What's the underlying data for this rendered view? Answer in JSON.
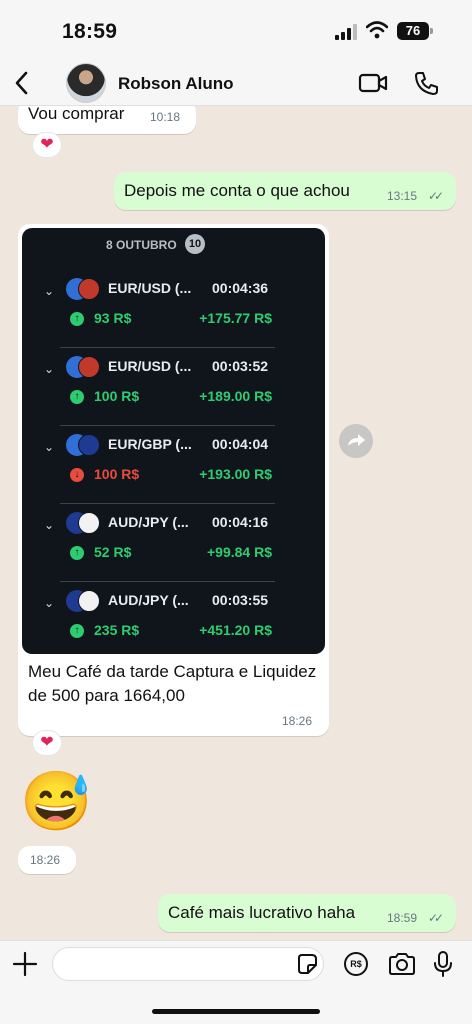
{
  "status": {
    "time": "18:59",
    "battery": "76"
  },
  "header": {
    "contact_name": "Robson Aluno"
  },
  "messages": {
    "m1": {
      "text": "Vou comprar",
      "time": "10:18",
      "reaction": "❤"
    },
    "m2": {
      "text": "Depois me conta o que achou",
      "time": "13:15",
      "ticks": "✓✓"
    },
    "m3": {
      "caption": "Meu Café da tarde Captura e Liquidez de 500 para 1664,00",
      "time": "18:26",
      "reaction": "❤",
      "image": {
        "date": "8 OUTUBRO",
        "count": "10",
        "trades": [
          {
            "pair": "EUR/USD (...",
            "duration": "00:04:36",
            "stake": "93 R$",
            "profit": "+175.77 R$",
            "direction": "up",
            "flags": [
              "#2f6fd6",
              "#c0392b"
            ]
          },
          {
            "pair": "EUR/USD (...",
            "duration": "00:03:52",
            "stake": "100 R$",
            "profit": "+189.00 R$",
            "direction": "up",
            "flags": [
              "#2f6fd6",
              "#c0392b"
            ]
          },
          {
            "pair": "EUR/GBP (...",
            "duration": "00:04:04",
            "stake": "100 R$",
            "profit": "+193.00 R$",
            "direction": "down",
            "flags": [
              "#2f6fd6",
              "#1f3a93"
            ]
          },
          {
            "pair": "AUD/JPY (...",
            "duration": "00:04:16",
            "stake": "52 R$",
            "profit": "+99.84 R$",
            "direction": "up",
            "flags": [
              "#1f3a93",
              "#f2f2f2"
            ]
          },
          {
            "pair": "AUD/JPY (...",
            "duration": "00:03:55",
            "stake": "235 R$",
            "profit": "+451.20 R$",
            "direction": "up",
            "flags": [
              "#1f3a93",
              "#f2f2f2"
            ]
          }
        ]
      }
    },
    "m4": {
      "emoji": "😅",
      "time": "18:26"
    },
    "m5": {
      "text": "Café mais lucrativo haha",
      "time": "18:59",
      "ticks": "✓✓"
    }
  },
  "input": {
    "placeholder": ""
  },
  "colors": {
    "outgoing": "#d9fdd3",
    "incoming": "#ffffff",
    "profit": "#2ecc71",
    "loss": "#e74c3c"
  }
}
